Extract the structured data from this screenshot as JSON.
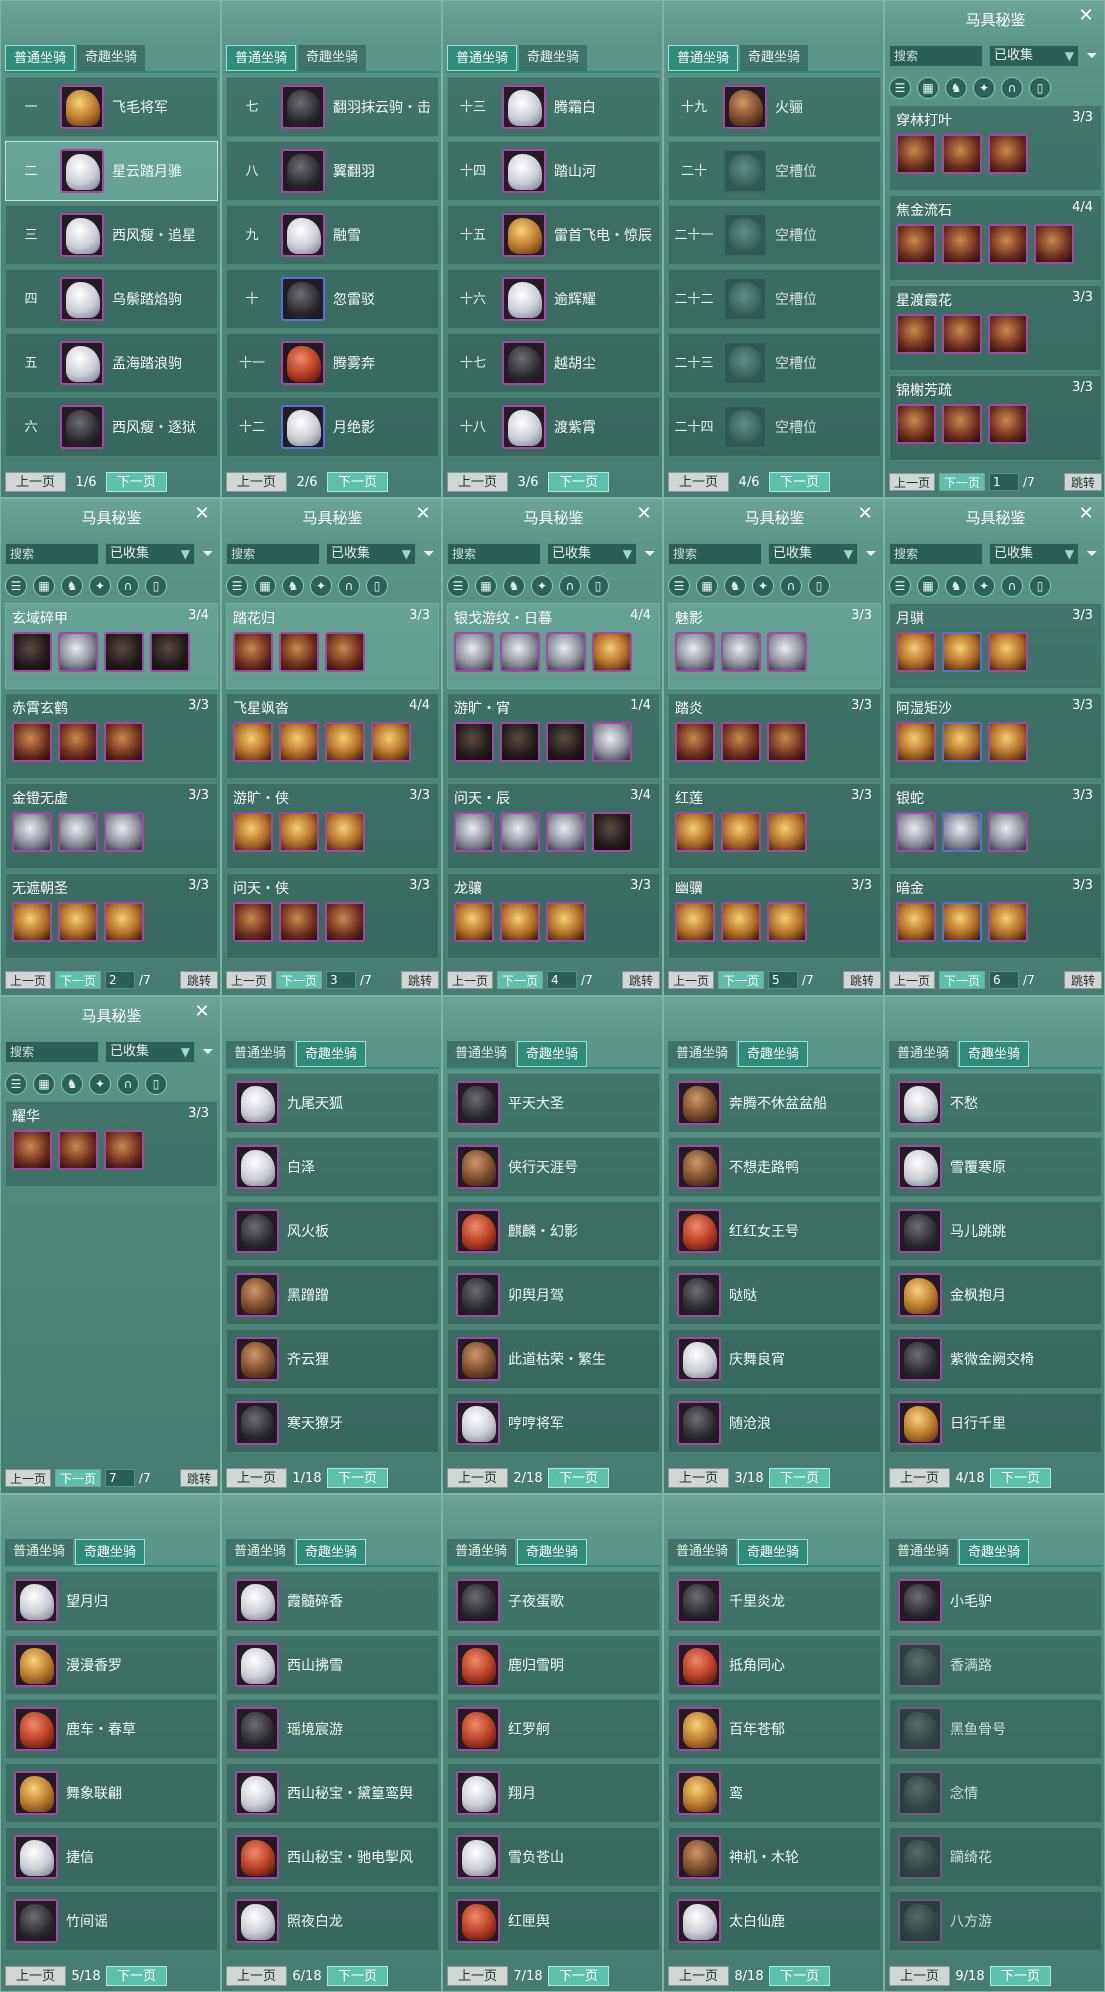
{
  "tabs": {
    "normal": "普通坐骑",
    "fun": "奇趣坐骑"
  },
  "pager": {
    "prev": "上一页",
    "next": "下一页"
  },
  "collection": {
    "title": "马具秘鉴",
    "search_placeholder": "搜索",
    "filter": "已收集",
    "goto": "跳转",
    "total": "/7",
    "prev": "上一页",
    "next": "下一页"
  },
  "mount_panels": [
    {
      "active_tab": "normal",
      "page": "1/6",
      "rows": [
        {
          "idx": "一",
          "name": "飞毛将军",
          "c": "g-gold"
        },
        {
          "idx": "二",
          "name": "星云踏月骓",
          "c": "g-white",
          "sel": true
        },
        {
          "idx": "三",
          "name": "西风瘦・追星",
          "c": "g-white"
        },
        {
          "idx": "四",
          "name": "乌鬃踏焰驹",
          "c": "g-white"
        },
        {
          "idx": "五",
          "name": "孟海踏浪驹",
          "c": "g-white"
        },
        {
          "idx": "六",
          "name": "西风瘦・逐狱",
          "c": "g-dark"
        }
      ]
    },
    {
      "active_tab": "normal",
      "page": "2/6",
      "rows": [
        {
          "idx": "七",
          "name": "翻羽抹云驹・击",
          "c": "g-dark"
        },
        {
          "idx": "八",
          "name": "翼翻羽",
          "c": "g-dark"
        },
        {
          "idx": "九",
          "name": "融雪",
          "c": "g-white"
        },
        {
          "idx": "十",
          "name": "忽雷驳",
          "c": "g-dark",
          "blue": true
        },
        {
          "idx": "十一",
          "name": "腾雾奔",
          "c": "g-red"
        },
        {
          "idx": "十二",
          "name": "月绝影",
          "c": "g-white",
          "blue": true
        }
      ]
    },
    {
      "active_tab": "normal",
      "page": "3/6",
      "rows": [
        {
          "idx": "十三",
          "name": "腾霜白",
          "c": "g-white"
        },
        {
          "idx": "十四",
          "name": "踏山河",
          "c": "g-white"
        },
        {
          "idx": "十五",
          "name": "雷首飞电・惊辰",
          "c": "g-gold"
        },
        {
          "idx": "十六",
          "name": "逾辉耀",
          "c": "g-white"
        },
        {
          "idx": "十七",
          "name": "越胡尘",
          "c": "g-dark"
        },
        {
          "idx": "十八",
          "name": "渡紫霄",
          "c": "g-white"
        }
      ]
    },
    {
      "active_tab": "normal",
      "page": "4/6",
      "rows": [
        {
          "idx": "十九",
          "name": "火骊",
          "c": "g-brown"
        },
        {
          "idx": "二十",
          "name": "空槽位",
          "c": "g-grey",
          "gray": true
        },
        {
          "idx": "二十一",
          "name": "空槽位",
          "c": "g-grey",
          "gray": true
        },
        {
          "idx": "二十二",
          "name": "空槽位",
          "c": "g-grey",
          "gray": true
        },
        {
          "idx": "二十三",
          "name": "空槽位",
          "c": "g-grey",
          "gray": true
        },
        {
          "idx": "二十四",
          "name": "空槽位",
          "c": "g-grey",
          "gray": true
        }
      ]
    }
  ],
  "collection_panels": [
    {
      "page": "1",
      "sets": [
        {
          "name": "穿林打叶",
          "prog": "3/3",
          "pieces": [
            "",
            "",
            ""
          ]
        },
        {
          "name": "焦金流石",
          "prog": "4/4",
          "pieces": [
            "",
            "",
            "",
            ""
          ]
        },
        {
          "name": "星渡霞花",
          "prog": "3/3",
          "pieces": [
            "",
            "",
            ""
          ]
        },
        {
          "name": "锦榭芳疏",
          "prog": "3/3",
          "pieces": [
            "",
            "",
            ""
          ]
        }
      ]
    },
    {
      "page": "2",
      "sets": [
        {
          "name": "玄域碎甲",
          "prog": "3/4",
          "pieces": [
            "dark",
            "silver",
            "dark",
            "dark"
          ]
        },
        {
          "name": "赤霄玄鹤",
          "prog": "3/3",
          "pieces": [
            "",
            "",
            ""
          ]
        },
        {
          "name": "金镫无虚",
          "prog": "3/3",
          "pieces": [
            "silver",
            "silver",
            "silver"
          ]
        },
        {
          "name": "无遮朝圣",
          "prog": "3/3",
          "pieces": [
            "gold",
            "gold",
            "gold"
          ]
        }
      ]
    },
    {
      "page": "3",
      "sets": [
        {
          "name": "踏花归",
          "prog": "3/3",
          "pieces": [
            "",
            "",
            ""
          ]
        },
        {
          "name": "飞星飒沓",
          "prog": "4/4",
          "pieces": [
            "gold",
            "gold",
            "gold",
            "gold"
          ]
        },
        {
          "name": "游旷・侠",
          "prog": "3/3",
          "pieces": [
            "gold",
            "gold",
            "gold"
          ]
        },
        {
          "name": "问天・侠",
          "prog": "3/3",
          "pieces": [
            "",
            "",
            ""
          ]
        }
      ]
    },
    {
      "page": "4",
      "sets": [
        {
          "name": "银戈游纹・日暮",
          "prog": "4/4",
          "pieces": [
            "silver",
            "silver",
            "silver",
            "gold"
          ]
        },
        {
          "name": "游旷・宵",
          "prog": "1/4",
          "pieces": [
            "dark",
            "dark",
            "dark",
            "silver"
          ]
        },
        {
          "name": "问天・辰",
          "prog": "3/4",
          "pieces": [
            "silver",
            "silver",
            "silver",
            "dark"
          ]
        },
        {
          "name": "龙骧",
          "prog": "3/3",
          "pieces": [
            "gold",
            "gold",
            "gold"
          ]
        }
      ]
    },
    {
      "page": "5",
      "sets": [
        {
          "name": "魅影",
          "prog": "3/3",
          "pieces": [
            "silver",
            "silver",
            "silver"
          ]
        },
        {
          "name": "踏炎",
          "prog": "3/3",
          "pieces": [
            "",
            "",
            ""
          ]
        },
        {
          "name": "红莲",
          "prog": "3/3",
          "pieces": [
            "gold",
            "gold",
            "gold"
          ]
        },
        {
          "name": "幽骥",
          "prog": "3/3",
          "pieces": [
            "gold",
            "gold",
            "gold"
          ]
        }
      ]
    },
    {
      "page": "6",
      "sets": [
        {
          "name": "月骐",
          "prog": "3/3",
          "pieces": [
            "gold",
            "gold",
            "gold"
          ]
        },
        {
          "name": "阿湿矩沙",
          "prog": "3/3",
          "pieces": [
            "gold",
            "gold",
            "gold"
          ]
        },
        {
          "name": "银蛇",
          "prog": "3/3",
          "pieces": [
            "silver",
            "silver",
            "silver"
          ]
        },
        {
          "name": "暗金",
          "prog": "3/3",
          "pieces": [
            "gold",
            "gold",
            "gold"
          ]
        }
      ]
    },
    {
      "page": "7",
      "sets": [
        {
          "name": "耀华",
          "prog": "3/3",
          "pieces": [
            "",
            "",
            ""
          ]
        }
      ]
    }
  ],
  "fun_panels": [
    {
      "page": "1/18",
      "rows": [
        {
          "name": "九尾天狐",
          "c": "g-white"
        },
        {
          "name": "白泽",
          "c": "g-white"
        },
        {
          "name": "风火板",
          "c": "g-dark"
        },
        {
          "name": "黑蹭蹭",
          "c": "g-brown"
        },
        {
          "name": "齐云狸",
          "c": "g-brown"
        },
        {
          "name": "寒天獠牙",
          "c": "g-dark"
        }
      ]
    },
    {
      "page": "2/18",
      "rows": [
        {
          "name": "平天大圣",
          "c": "g-dark"
        },
        {
          "name": "侠行天涯号",
          "c": "g-brown"
        },
        {
          "name": "麒麟・幻影",
          "c": "g-red"
        },
        {
          "name": "卯舆月驾",
          "c": "g-dark"
        },
        {
          "name": "此道枯荣・繁生",
          "c": "g-brown"
        },
        {
          "name": "哼哼将军",
          "c": "g-white"
        }
      ]
    },
    {
      "page": "3/18",
      "rows": [
        {
          "name": "奔腾不休盆盆船",
          "c": "g-brown"
        },
        {
          "name": "不想走路鸭",
          "c": "g-brown"
        },
        {
          "name": "红红女王号",
          "c": "g-red"
        },
        {
          "name": "哒哒",
          "c": "g-dark"
        },
        {
          "name": "庆舞良宵",
          "c": "g-white"
        },
        {
          "name": "随沧浪",
          "c": "g-dark"
        }
      ]
    },
    {
      "page": "4/18",
      "rows": [
        {
          "name": "不愁",
          "c": "g-white"
        },
        {
          "name": "雪覆寒原",
          "c": "g-white"
        },
        {
          "name": "马儿跳跳",
          "c": "g-dark"
        },
        {
          "name": "金枫抱月",
          "c": "g-gold"
        },
        {
          "name": "紫微金阙交椅",
          "c": "g-dark"
        },
        {
          "name": "日行千里",
          "c": "g-gold"
        }
      ]
    },
    {
      "page": "5/18",
      "rows": [
        {
          "name": "望月归",
          "c": "g-white"
        },
        {
          "name": "漫漫香罗",
          "c": "g-gold"
        },
        {
          "name": "鹿车・春草",
          "c": "g-red"
        },
        {
          "name": "舞象联翩",
          "c": "g-gold"
        },
        {
          "name": "捷信",
          "c": "g-white"
        },
        {
          "name": "竹间谣",
          "c": "g-dark"
        }
      ]
    },
    {
      "page": "6/18",
      "rows": [
        {
          "name": "霞髓碎香",
          "c": "g-white"
        },
        {
          "name": "西山拂雪",
          "c": "g-white"
        },
        {
          "name": "瑶境宸游",
          "c": "g-dark"
        },
        {
          "name": "西山秘宝・黛篁鸾舆",
          "c": "g-white"
        },
        {
          "name": "西山秘宝・驰电掣风",
          "c": "g-red"
        },
        {
          "name": "照夜白龙",
          "c": "g-white"
        }
      ]
    },
    {
      "page": "7/18",
      "rows": [
        {
          "name": "子夜蛋歌",
          "c": "g-dark"
        },
        {
          "name": "鹿归雪明",
          "c": "g-red"
        },
        {
          "name": "红罗舸",
          "c": "g-red"
        },
        {
          "name": "翔月",
          "c": "g-white"
        },
        {
          "name": "雪负苍山",
          "c": "g-white"
        },
        {
          "name": "红匣舆",
          "c": "g-red"
        }
      ]
    },
    {
      "page": "8/18",
      "rows": [
        {
          "name": "千里炎龙",
          "c": "g-dark"
        },
        {
          "name": "抵角同心",
          "c": "g-red"
        },
        {
          "name": "百年苍郁",
          "c": "g-gold"
        },
        {
          "name": "鸾",
          "c": "g-gold"
        },
        {
          "name": "神机・木轮",
          "c": "g-brown"
        },
        {
          "name": "太白仙鹿",
          "c": "g-white"
        }
      ]
    },
    {
      "page": "9/18",
      "rows": [
        {
          "name": "小毛驴",
          "c": "g-dark"
        },
        {
          "name": "香满路",
          "c": "g-dark",
          "dim": true
        },
        {
          "name": "黑鱼骨号",
          "c": "g-dark",
          "dim": true
        },
        {
          "name": "念情",
          "c": "g-dark",
          "dim": true
        },
        {
          "name": "躏绮花",
          "c": "g-dark",
          "dim": true
        },
        {
          "name": "八方游",
          "c": "g-dark",
          "dim": true
        }
      ]
    }
  ]
}
